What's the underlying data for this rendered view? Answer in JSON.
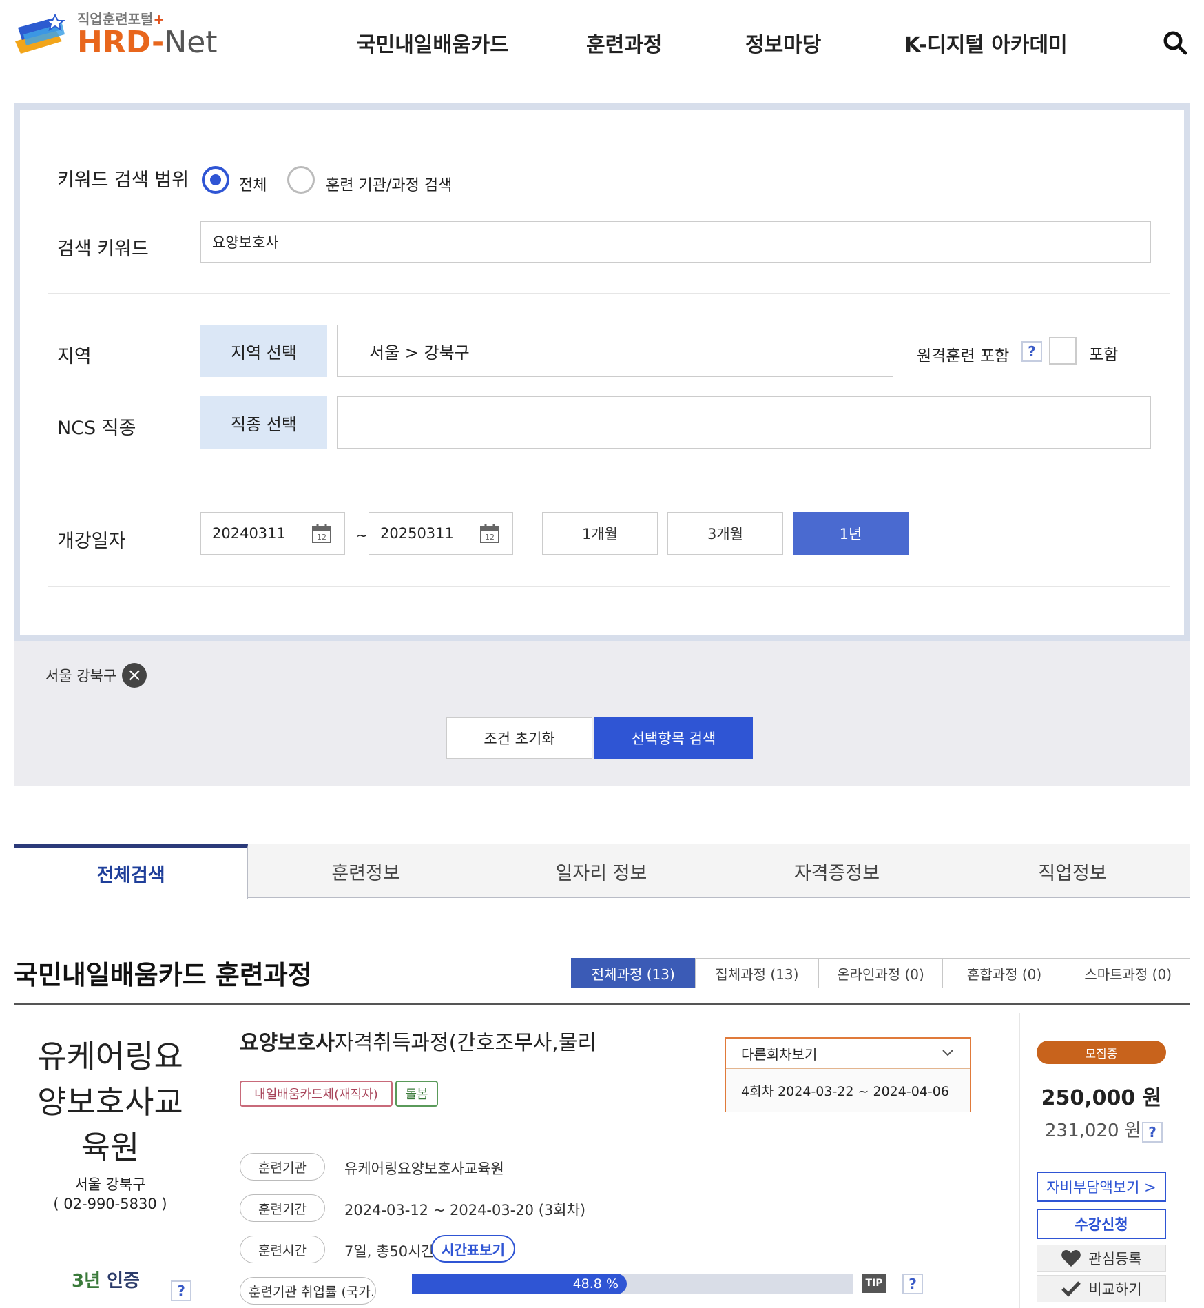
{
  "brand": {
    "sub": "직업훈련포털",
    "plus": "+",
    "name_main": "HRD-",
    "name_end": "Net"
  },
  "nav": [
    "국민내일배움카드",
    "훈련과정",
    "정보마당",
    "K-디지털 아카데미"
  ],
  "search": {
    "keyword_scope_label": "키워드 검색 범위",
    "scope_options": [
      "전체",
      "훈련 기관/과정 검색"
    ],
    "keyword_label": "검색 키워드",
    "keyword_value": "요양보호사",
    "region_label": "지역",
    "region_button": "지역 선택",
    "region_value": "서울 > 강북구",
    "remote_label": "원격훈련 포함",
    "remote_check_label": "포함",
    "ncs_label": "NCS 직종",
    "ncs_button": "직종 선택",
    "ncs_value": "",
    "date_label": "개강일자",
    "date_from": "20240311",
    "date_sep": "~",
    "date_to": "20250311",
    "periods": [
      "1개월",
      "3개월",
      "1년"
    ],
    "active_period": "1년",
    "filter_chip": "서울 강북구",
    "reset_button": "조건 초기화",
    "search_button": "선택항목 검색",
    "help_mark": "?"
  },
  "tabs": [
    "전체검색",
    "훈련정보",
    "일자리 정보",
    "자격증정보",
    "직업정보"
  ],
  "section": {
    "title": "국민내일배움카드 훈련과정",
    "subtabs": [
      "전체과정 (13)",
      "집체과정 (13)",
      "온라인과정 (0)",
      "혼합과정 (0)",
      "스마트과정 (0)"
    ]
  },
  "course": {
    "institution": "유케어링요양보호사교육원",
    "institution_region": "서울 강북구",
    "institution_phone": "( 02-990-5830 )",
    "cert_years": "3년",
    "cert_label": "인증",
    "title_highlight": "요양보호사",
    "title_rest": "자격취득과정(간호조무사,물리…",
    "badges": [
      "내일배움카드제(재직자)",
      "돌봄"
    ],
    "info_labels": [
      "훈련기관",
      "훈련기간",
      "훈련시간",
      "훈련기관 취업률 (국가…"
    ],
    "info_values": [
      "유케어링요양보호사교육원",
      "2024-03-12 ~ 2024-03-20 (3회차)",
      "7일, 총50시간"
    ],
    "timetable_button": "시간표보기",
    "employment_rate": 48.8,
    "employment_rate_text": "48.8 %",
    "tip_label": "TIP",
    "other_rounds_label": "다른회차보기",
    "selected_round": "4회차 2024-03-22 ~ 2024-04-06",
    "status": "모집중",
    "price": "250,000 원",
    "support_price": "231,020 원",
    "self_pay_button": "자비부담액보기 >",
    "apply_button": "수강신청",
    "wishlist_button": "관심등록",
    "compare_button": "비교하기"
  },
  "colors": {
    "accent": "#2f55d4",
    "brand_orange": "#e8661c",
    "status_orange": "#c8631c"
  }
}
